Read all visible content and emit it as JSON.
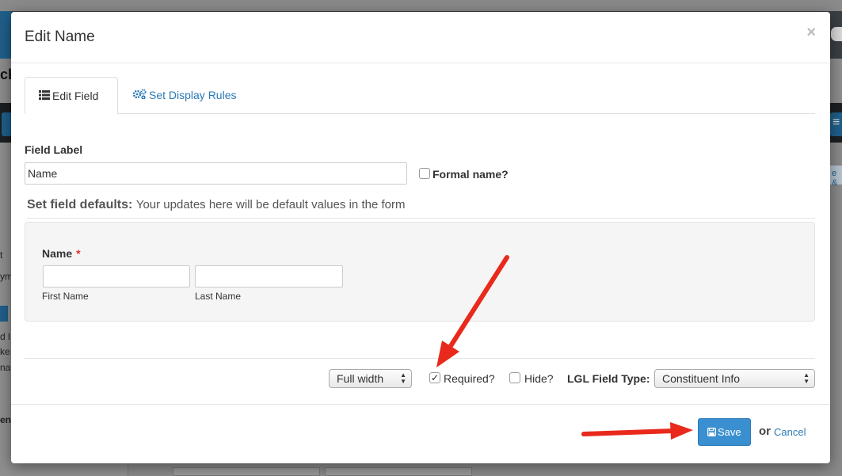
{
  "background": {
    "breadcrumb_fragment": "ck",
    "side_fragments": [
      "t",
      "ym",
      "d l",
      "ke",
      "na",
      "en"
    ],
    "right_tag": "e &"
  },
  "modal": {
    "title": "Edit Name",
    "close_symbol": "×",
    "tabs": [
      {
        "label": "Edit Field",
        "icon": "list-icon",
        "active": true
      },
      {
        "label": "Set Display Rules",
        "icon": "gears-icon",
        "active": false
      }
    ],
    "field_label": {
      "label": "Field Label",
      "value": "Name",
      "formal_checkbox_label": "Formal name?",
      "formal_checked": false
    },
    "defaults": {
      "title_bold": "Set field defaults:",
      "title_rest": "Your updates here will be default values in the form"
    },
    "name_field": {
      "label": "Name",
      "required_mark": "*",
      "first_sub": "First Name",
      "last_sub": "Last Name",
      "first_value": "",
      "last_value": ""
    },
    "options": {
      "width_select": "Full width",
      "required_label": "Required?",
      "required_checked": true,
      "hide_label": "Hide?",
      "hide_checked": false,
      "lgl_type_label": "LGL Field Type:",
      "lgl_type_value": "Constituent Info"
    },
    "footer": {
      "save_label": "Save",
      "or_text": "or",
      "cancel_label": "Cancel"
    }
  },
  "annotation_color": "#e8291c"
}
